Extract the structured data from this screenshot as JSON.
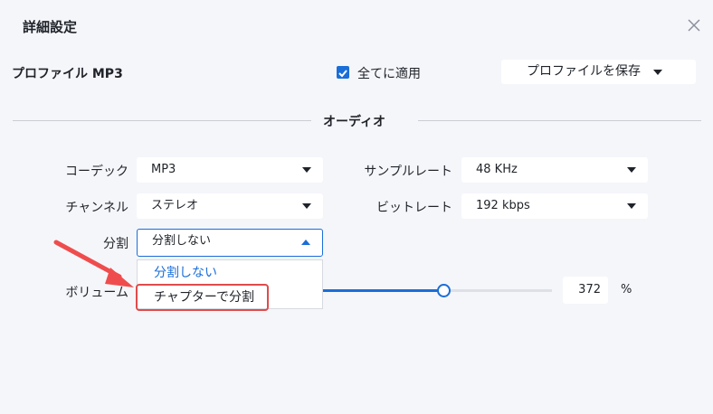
{
  "dialog": {
    "title": "詳細設定"
  },
  "header": {
    "profile_label": "プロファイル  MP3",
    "apply_all_label": "全てに適用",
    "apply_all_checked": true,
    "save_profile_label": "プロファイルを保存"
  },
  "section": {
    "title": "オーディオ"
  },
  "fields": {
    "codec": {
      "label": "コーデック",
      "value": "MP3"
    },
    "sample_rate": {
      "label": "サンプルレート",
      "value": "48 KHz"
    },
    "channel": {
      "label": "チャンネル",
      "value": "ステレオ"
    },
    "bitrate": {
      "label": "ビットレート",
      "value": "192 kbps"
    },
    "split": {
      "label": "分割",
      "value": "分割しない",
      "options": [
        "分割しない",
        "チャプターで分割"
      ]
    },
    "volume": {
      "label": "ボリューム",
      "value": "372",
      "unit": "%",
      "slider_fraction": 0.52
    }
  },
  "colors": {
    "accent": "#1a6ed8",
    "highlight": "#e04b4b",
    "arrow": "#ef4d4d"
  }
}
